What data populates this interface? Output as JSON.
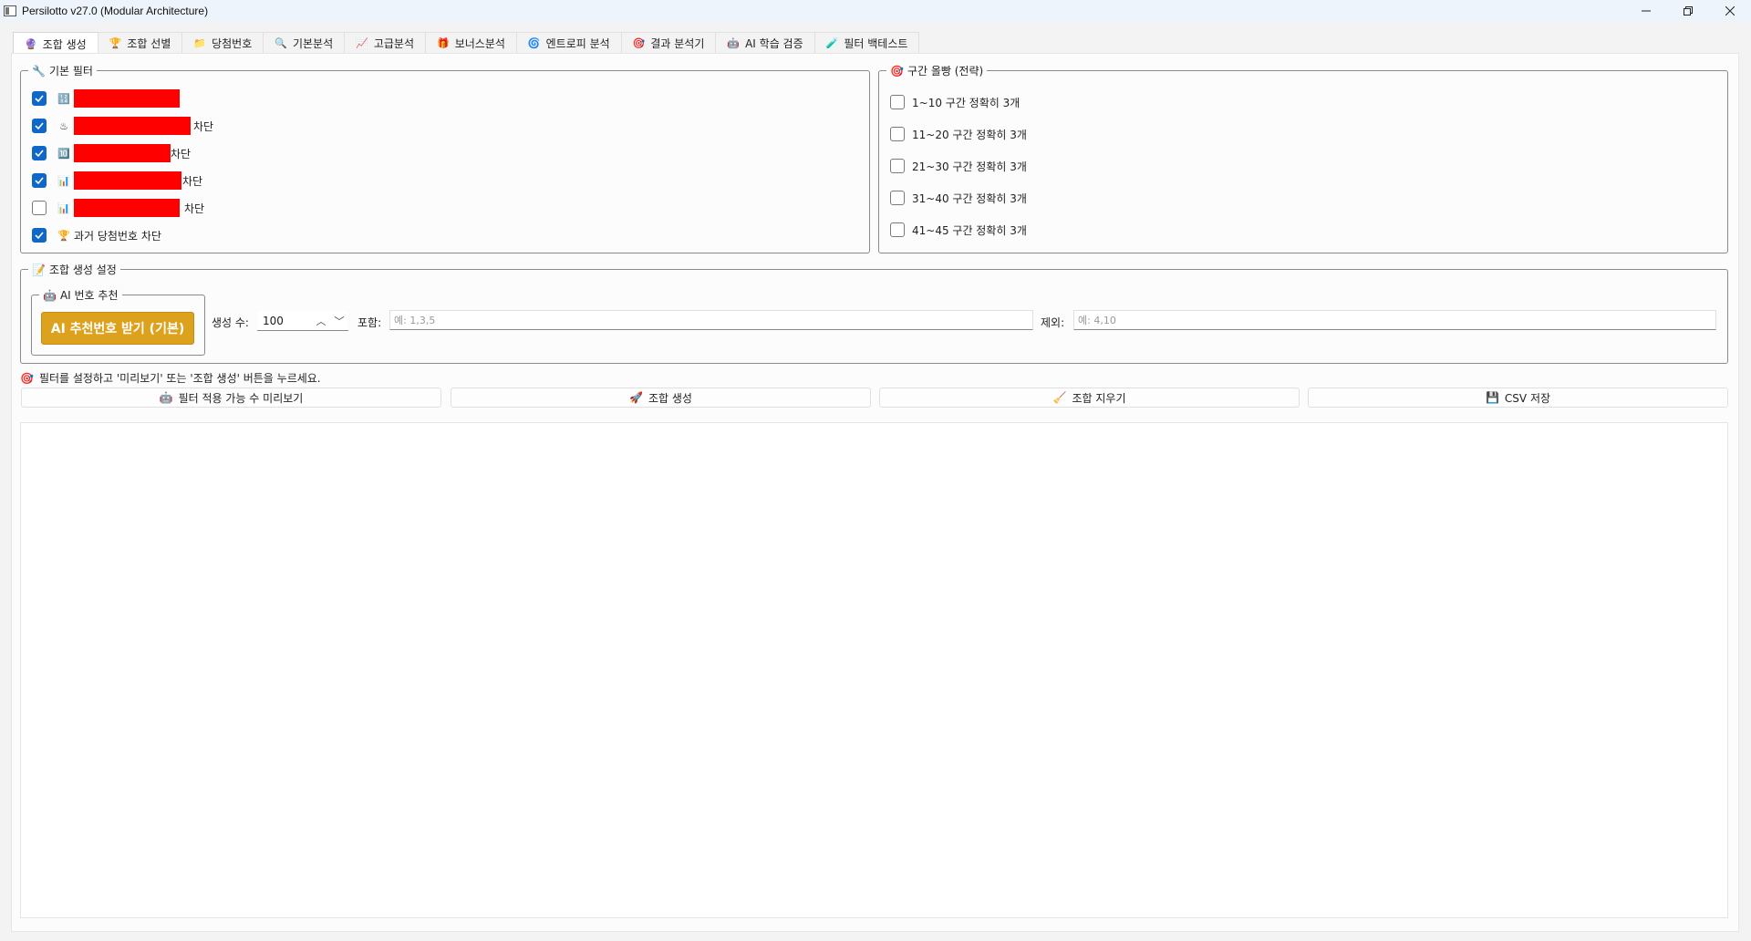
{
  "window": {
    "title": "Persilotto v27.0 (Modular Architecture)",
    "controls": {
      "minimize": "—",
      "restore": "❐",
      "close": "✕"
    }
  },
  "tabs": [
    {
      "label": "조합 생성",
      "icon": "🔮",
      "active": true
    },
    {
      "label": "조합 선별",
      "icon": "🏆",
      "active": false
    },
    {
      "label": "당첨번호",
      "icon": "📁",
      "active": false
    },
    {
      "label": "기본분석",
      "icon": "🔍",
      "active": false
    },
    {
      "label": "고급분석",
      "icon": "📈",
      "active": false
    },
    {
      "label": "보너스분석",
      "icon": "🎁",
      "active": false
    },
    {
      "label": "엔트로피 분석",
      "icon": "🌀",
      "active": false
    },
    {
      "label": "결과 분석기",
      "icon": "🎯",
      "active": false
    },
    {
      "label": "AI 학습  검증",
      "icon": "🤖",
      "active": false
    },
    {
      "label": "필터 백테스트",
      "icon": "🧪",
      "active": false
    }
  ],
  "basic_filter": {
    "title": "기본 필터",
    "title_icon": "🔧",
    "items": [
      {
        "checked": true,
        "icon": "🔢",
        "suffix": ""
      },
      {
        "checked": true,
        "icon": "♨",
        "suffix": "차단"
      },
      {
        "checked": true,
        "icon": "🔟",
        "suffix": "차단"
      },
      {
        "checked": true,
        "icon": "📊",
        "suffix": "차단"
      },
      {
        "checked": false,
        "icon": "📊",
        "suffix": "차단"
      },
      {
        "checked": true,
        "icon": "🏆",
        "suffix": "과거 당첨번호 차단"
      }
    ]
  },
  "range_strategy": {
    "title": "구간 올빵 (전략)",
    "title_icon": "🎯",
    "items": [
      {
        "checked": false,
        "label": "1~10 구간 정확히 3개"
      },
      {
        "checked": false,
        "label": "11~20 구간 정확히 3개"
      },
      {
        "checked": false,
        "label": "21~30 구간 정확히 3개"
      },
      {
        "checked": false,
        "label": "31~40 구간 정확히 3개"
      },
      {
        "checked": false,
        "label": "41~45 구간 정확히 3개"
      }
    ]
  },
  "generation_settings": {
    "title": "조합 생성 설정",
    "title_icon": "📝",
    "ai_group_title": "AI 번호 추천",
    "ai_group_icon": "🤖",
    "ai_button": "AI 추천번호 받기 (기본)",
    "count_label": "생성 수:",
    "count_value": "100",
    "include_label": "포함:",
    "include_placeholder": "예: 1,3,5",
    "exclude_label": "제외:",
    "exclude_placeholder": "예: 4,10"
  },
  "status": {
    "icon": "🎯",
    "text": "필터를 설정하고 '미리보기' 또는 '조합 생성' 버튼을 누르세요."
  },
  "actions": [
    {
      "icon": "🤖",
      "label": "필터 적용 가능 수 미리보기"
    },
    {
      "icon": "🚀",
      "label": "조합 생성"
    },
    {
      "icon": "🧹",
      "label": "조합 지우기"
    },
    {
      "icon": "💾",
      "label": "CSV 저장"
    }
  ],
  "colors": {
    "accent": "#0f67c9",
    "ai_button": "#dca21e",
    "redaction": "#ff0000"
  }
}
